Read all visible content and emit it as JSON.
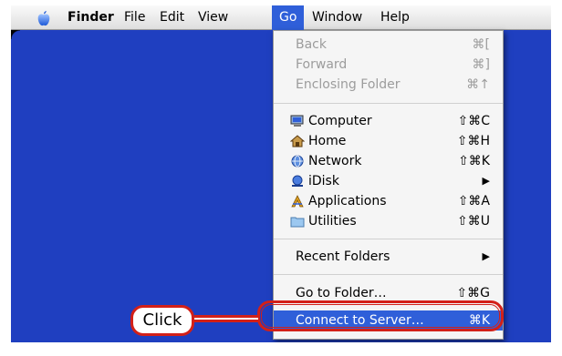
{
  "menubar": {
    "items": [
      {
        "label": "Finder"
      },
      {
        "label": "File"
      },
      {
        "label": "Edit"
      },
      {
        "label": "View"
      },
      {
        "label": "Go"
      },
      {
        "label": "Window"
      },
      {
        "label": "Help"
      }
    ]
  },
  "menu": {
    "items": [
      {
        "label": "Back",
        "shortcut": "⌘["
      },
      {
        "label": "Forward",
        "shortcut": "⌘]"
      },
      {
        "label": "Enclosing Folder",
        "shortcut": "⌘↑"
      },
      {
        "label": "Computer",
        "shortcut": "⇧⌘C",
        "icon": "computer-icon"
      },
      {
        "label": "Home",
        "shortcut": "⇧⌘H",
        "icon": "home-icon"
      },
      {
        "label": "Network",
        "shortcut": "⇧⌘K",
        "icon": "network-icon"
      },
      {
        "label": "iDisk",
        "shortcut": "▶",
        "icon": "idisk-icon"
      },
      {
        "label": "Applications",
        "shortcut": "⇧⌘A",
        "icon": "applications-icon"
      },
      {
        "label": "Utilities",
        "shortcut": "⇧⌘U",
        "icon": "utilities-icon"
      },
      {
        "label": "Recent Folders",
        "shortcut": "▶"
      },
      {
        "label": "Go to Folder…",
        "shortcut": "⇧⌘G"
      },
      {
        "label": "Connect to Server…",
        "shortcut": "⌘K"
      }
    ]
  },
  "callout": {
    "label": "Click"
  },
  "colors": {
    "desktop": "#1f3fc0",
    "highlight": "#2f5fd9",
    "callout": "#d32018"
  }
}
